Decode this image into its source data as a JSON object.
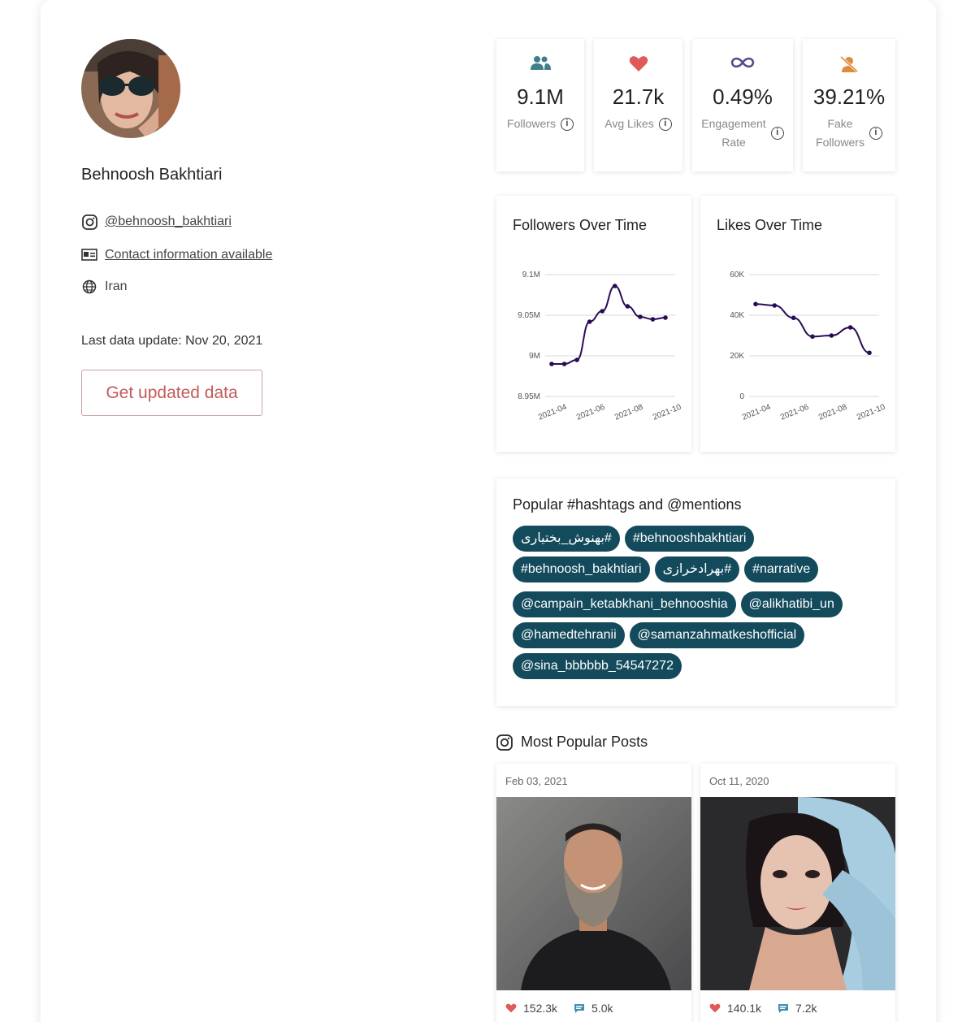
{
  "profile": {
    "name": "Behnoosh Bakhtiari",
    "instagram_handle": "@behnoosh_bakhtiari",
    "contact_text": "Contact information available",
    "country": "Iran",
    "last_update": "Last data update: Nov 20, 2021",
    "update_button": "Get updated data"
  },
  "stats": [
    {
      "icon": "followers-icon",
      "value": "9.1M",
      "label_lines": [
        "Followers"
      ]
    },
    {
      "icon": "heart-icon",
      "value": "21.7k",
      "label_lines": [
        "Avg Likes"
      ]
    },
    {
      "icon": "infinity-icon",
      "value": "0.49%",
      "label_lines": [
        "Engagement",
        "Rate"
      ]
    },
    {
      "icon": "fake-followers-icon",
      "value": "39.21%",
      "label_lines": [
        "Fake",
        "Followers"
      ]
    }
  ],
  "charts": {
    "followers": {
      "title": "Followers Over Time",
      "y_ticks": [
        "9.1M",
        "9.05M",
        "9M",
        "8.95M"
      ],
      "x_ticks": [
        "2021-04",
        "2021-06",
        "2021-08",
        "2021-10"
      ]
    },
    "likes": {
      "title": "Likes Over Time",
      "y_ticks": [
        "60K",
        "40K",
        "20K",
        "0"
      ],
      "x_ticks": [
        "2021-04",
        "2021-06",
        "2021-08",
        "2021-10"
      ]
    }
  },
  "chart_data": [
    {
      "type": "line",
      "title": "Followers Over Time",
      "x": [
        "2021-04",
        "2021-05",
        "2021-06",
        "2021-06b",
        "2021-07",
        "2021-07b",
        "2021-08",
        "2021-09",
        "2021-10",
        "2021-10b"
      ],
      "values": [
        8.99,
        8.99,
        8.995,
        9.042,
        9.055,
        9.086,
        9.061,
        9.048,
        9.045,
        9.047
      ],
      "ylim": [
        8.95,
        9.1
      ],
      "line_color": "#2a0a55"
    },
    {
      "type": "line",
      "title": "Likes Over Time",
      "x": [
        "2021-04",
        "2021-05",
        "2021-06",
        "2021-07",
        "2021-08",
        "2021-09",
        "2021-10"
      ],
      "values": [
        45500,
        44800,
        38700,
        29500,
        30000,
        34000,
        21500
      ],
      "ylim": [
        0,
        60000
      ],
      "line_color": "#2a0a55"
    }
  ],
  "hashtags": {
    "title": "Popular #hashtags and @mentions",
    "tags": [
      "#بهنوش_بختیاری",
      "#behnooshbakhtiari",
      "#behnoosh_bakhtiari",
      "#بهرادخرازی",
      "#narrative"
    ],
    "mentions": [
      "@campain_ketabkhani_behnooshia",
      "@alikhatibi_un",
      "@hamedtehranii",
      "@samanzahmatkeshofficial",
      "@sina_bbbbbb_54547272"
    ],
    "tag_color": "#134a5c"
  },
  "posts": {
    "title": "Most Popular Posts",
    "items": [
      {
        "date": "Feb 03, 2021",
        "likes": "152.3k",
        "comments": "5.0k"
      },
      {
        "date": "Oct 11, 2020",
        "likes": "140.1k",
        "comments": "7.2k"
      }
    ]
  },
  "colors": {
    "accent_red": "#e05a5a",
    "teal": "#3e7f8a",
    "purple": "#5a4a8a",
    "orange": "#e08a3c"
  }
}
